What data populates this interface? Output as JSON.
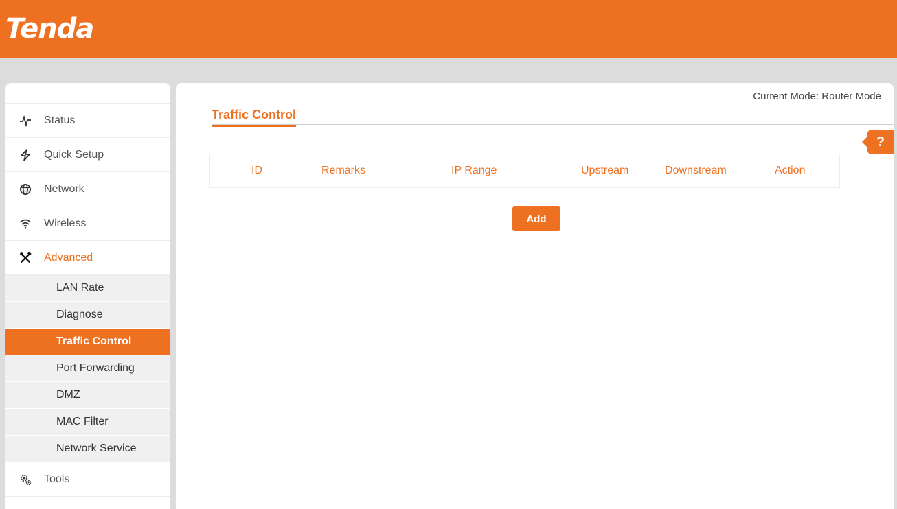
{
  "brand": {
    "logo_text": "Tenda",
    "accent_color": "#ee7021"
  },
  "header": {
    "mode_label": "Current Mode: Router Mode"
  },
  "sidebar": {
    "items": [
      {
        "label": "Status",
        "icon": "pulse-icon"
      },
      {
        "label": "Quick Setup",
        "icon": "flash-icon"
      },
      {
        "label": "Network",
        "icon": "globe-icon"
      },
      {
        "label": "Wireless",
        "icon": "wifi-icon"
      },
      {
        "label": "Advanced",
        "icon": "tools-icon",
        "active": true
      },
      {
        "label": "Tools",
        "icon": "gears-icon"
      }
    ],
    "advanced_subitems": [
      {
        "label": "LAN Rate"
      },
      {
        "label": "Diagnose"
      },
      {
        "label": "Traffic Control",
        "selected": true
      },
      {
        "label": "Port Forwarding"
      },
      {
        "label": "DMZ"
      },
      {
        "label": "MAC Filter"
      },
      {
        "label": "Network Service"
      }
    ]
  },
  "main": {
    "title": "Traffic Control",
    "help_label": "?",
    "table": {
      "columns": [
        "ID",
        "Remarks",
        "IP Range",
        "Upstream",
        "Downstream",
        "Action"
      ],
      "rows": []
    },
    "add_button": "Add"
  }
}
